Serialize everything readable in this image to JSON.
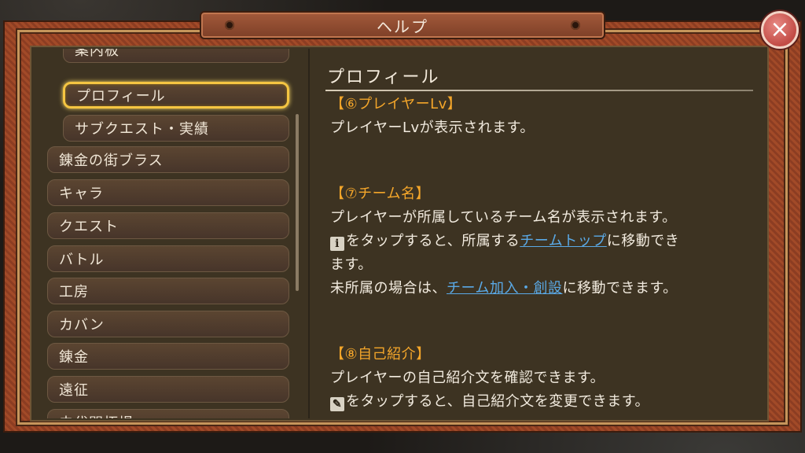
{
  "window": {
    "title": "ヘルプ",
    "close_label": "×"
  },
  "sidebar": {
    "items": [
      {
        "label": "案内板",
        "level": "sub",
        "selected": false
      },
      {
        "label": "プロフィール",
        "level": "sub",
        "selected": true
      },
      {
        "label": "サブクエスト・実績",
        "level": "sub",
        "selected": false
      },
      {
        "label": "錬金の街ブラス",
        "level": "top",
        "selected": false
      },
      {
        "label": "キャラ",
        "level": "top",
        "selected": false
      },
      {
        "label": "クエスト",
        "level": "top",
        "selected": false
      },
      {
        "label": "バトル",
        "level": "top",
        "selected": false
      },
      {
        "label": "工房",
        "level": "top",
        "selected": false
      },
      {
        "label": "カバン",
        "level": "top",
        "selected": false
      },
      {
        "label": "錬金",
        "level": "top",
        "selected": false
      },
      {
        "label": "遠征",
        "level": "top",
        "selected": false
      },
      {
        "label": "未代開拓場",
        "level": "top",
        "selected": false
      }
    ]
  },
  "main": {
    "section_title": "プロフィール",
    "sections": [
      {
        "heading": "【⑥プレイヤーLv】",
        "line1": "プレイヤーLvが表示されます。"
      },
      {
        "heading": "【⑦チーム名】",
        "line1": "プレイヤーが所属しているチーム名が表示されます。",
        "line2_icon": "i",
        "line2_a": "をタップすると、所属する",
        "line2_link": "チームトップ",
        "line2_b": "に移動でき",
        "line3": "ます。",
        "line4_a": "未所属の場合は、",
        "line4_link": "チーム加入・創設",
        "line4_b": "に移動できます。"
      },
      {
        "heading": "【⑧自己紹介】",
        "line1": "プレイヤーの自己紹介文を確認できます。",
        "line2_icon": "✎",
        "line2": "をタップすると、自己紹介文を変更できます。"
      }
    ]
  },
  "colors": {
    "heading": "#f4a62a",
    "link": "#5aa9e6",
    "selected_border": "#f5c542",
    "panel": "#3d3322"
  }
}
